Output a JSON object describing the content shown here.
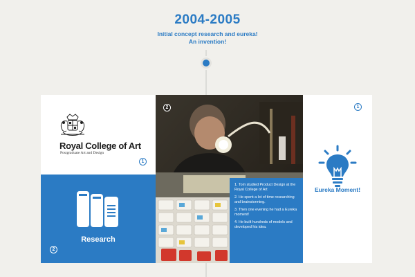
{
  "header": {
    "year": "2004-2005",
    "subtitle_line1": "Initial concept research and eureka!",
    "subtitle_line2": "An invention!"
  },
  "rca_panel": {
    "title": "Royal College of Art",
    "subtitle": "Postgraduate Art and Design",
    "number": "1"
  },
  "research_panel": {
    "label": "Research",
    "number": "2"
  },
  "photo_panel": {
    "number": "2",
    "notes": [
      "1. Tom studied Product Design at the Royal College of Art",
      "2. He spent a lot of time researching and brainstorming.",
      "3. Then one evening he had a Eureka moment!",
      "4. He built hundreds of models and developed his idea."
    ]
  },
  "eureka_panel": {
    "label": "Eureka Moment!",
    "number": "1"
  },
  "colors": {
    "accent": "#2b7bc4",
    "background": "#f1f0ec"
  }
}
